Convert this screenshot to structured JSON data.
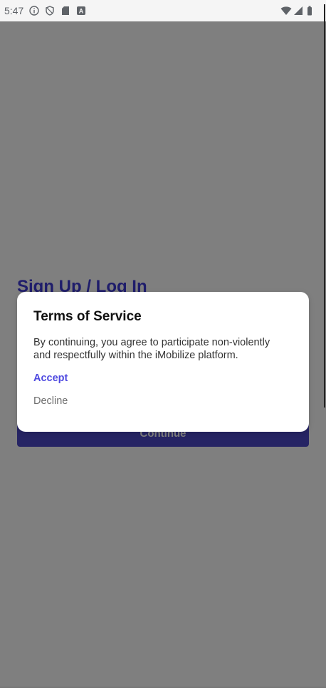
{
  "status_bar": {
    "time": "5:47",
    "left_icons": [
      "info-icon",
      "shield-icon",
      "sd-card-icon",
      "a-badge-icon"
    ],
    "right_icons": [
      "wifi-icon",
      "cell-signal-icon",
      "battery-icon"
    ]
  },
  "background": {
    "heading": "Sign Up / Log In",
    "continue_label": "Continue",
    "accent_color": "#4c48c8"
  },
  "dialog": {
    "title": "Terms of Service",
    "body": "By continuing, you agree to participate non-violently\nand respectfully within the iMobilize platform.",
    "accept_label": "Accept",
    "decline_label": "Decline",
    "accept_color": "#4f4ae0",
    "decline_color": "#6e6e6e"
  }
}
